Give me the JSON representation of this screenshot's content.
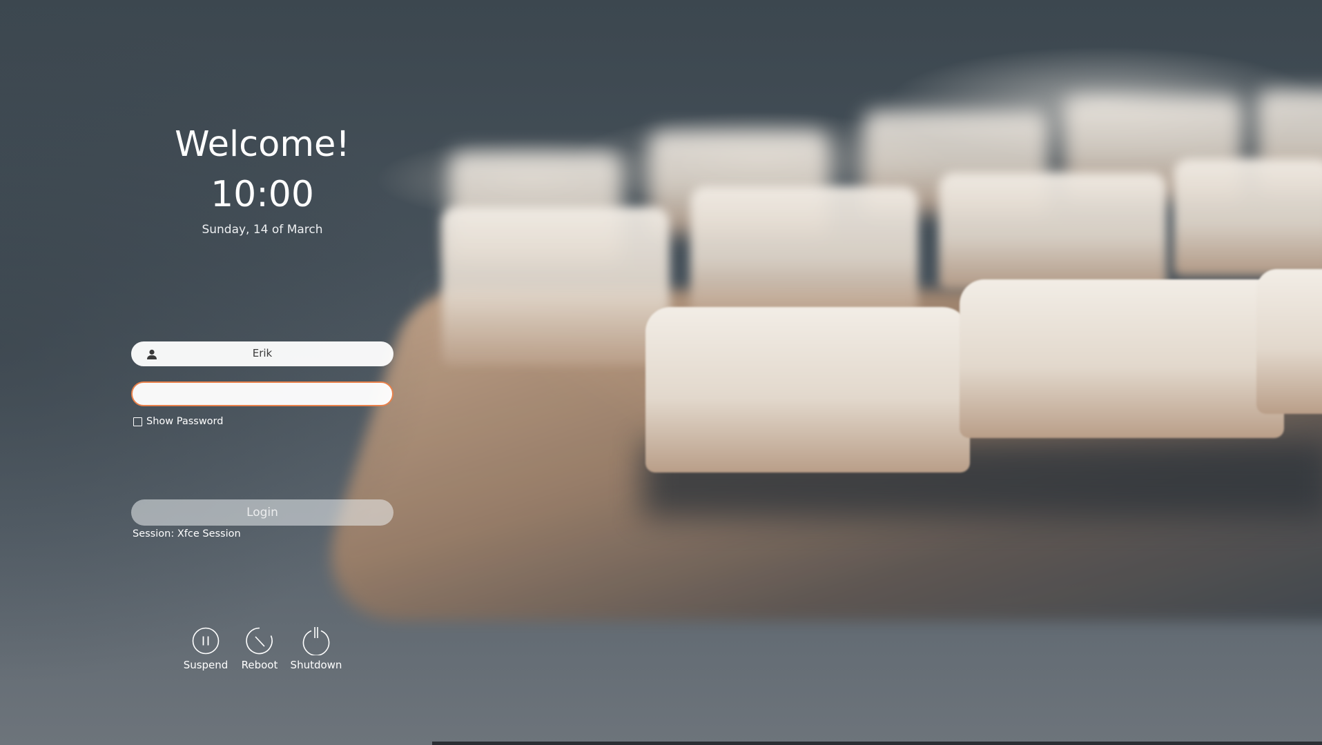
{
  "greeter": {
    "welcome": "Welcome!",
    "time": "10:00",
    "date": "Sunday, 14 of March"
  },
  "login": {
    "username": "Erik",
    "password_value": "",
    "show_password_label": "Show Password",
    "show_password_checked": false,
    "login_label": "Login",
    "session_label": "Session: Xfce Session"
  },
  "power": {
    "suspend_label": "Suspend",
    "reboot_label": "Reboot",
    "shutdown_label": "Shutdown"
  },
  "colors": {
    "focus_accent": "#e8804a",
    "text": "#ffffff"
  },
  "icons": {
    "user": "user-icon",
    "suspend": "pause-circle-icon",
    "reboot": "reboot-icon",
    "shutdown": "power-icon"
  }
}
